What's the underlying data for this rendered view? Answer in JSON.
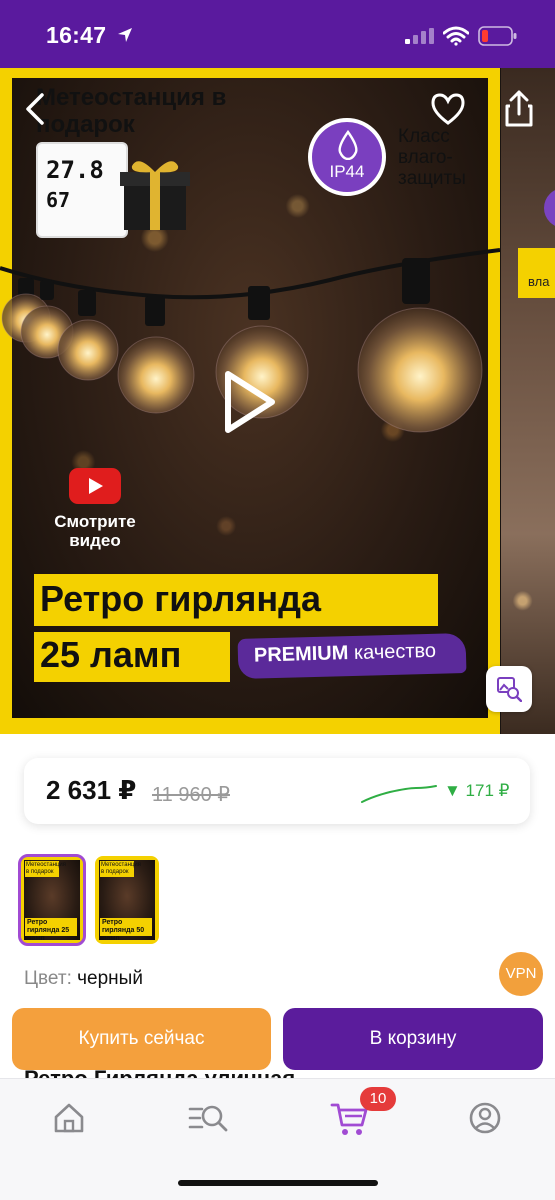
{
  "status_bar": {
    "time": "16:47"
  },
  "promo": {
    "gift_title": "Метеостанция в подарок",
    "weather_temp": "27.8",
    "weather_hum": "67",
    "ip_rating": "IP44",
    "ip_caption": "Класс влаго-защиты",
    "video_cta": "Смотрите видео",
    "title_line_1": "Ретро гирлянда",
    "title_line_2": "25 ламп",
    "premium_bold": "PREMIUM",
    "premium_text": "качество",
    "next_slide_text": "вла"
  },
  "price": {
    "current": "2 631 ₽",
    "old": "11 960 ₽",
    "drop": "▼ 171 ₽"
  },
  "variants": [
    {
      "top": "Метеостанция в подарок",
      "caption": "Ретро гирлянда 25 ламп"
    },
    {
      "top": "Метеостанция в подарок",
      "caption": "Ретро гирлянда 50 ламп"
    }
  ],
  "color": {
    "label": "Цвет:",
    "value": "черный"
  },
  "vpn_badge": "VPN",
  "product_title_obscured": "Ретро Гирлянда уличная",
  "actions": {
    "buy_now": "Купить сейчас",
    "add_to_cart": "В корзину"
  },
  "tab_bar": {
    "cart_count": "10"
  },
  "colors": {
    "brand_purple": "#5b1c9c",
    "accent_orange": "#f4a03d",
    "promo_yellow": "#f4d100",
    "price_drop_green": "#2fae44"
  }
}
